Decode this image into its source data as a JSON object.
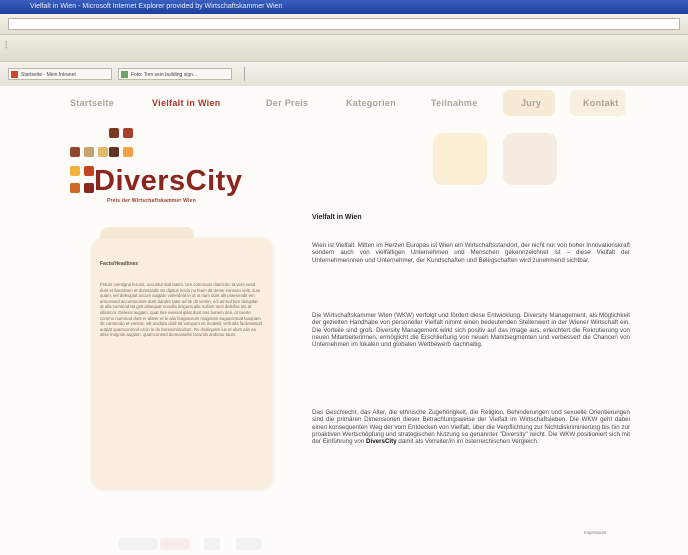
{
  "browser": {
    "title": "Vielfalt in Wien - Microsoft Internet Explorer provided by Wirtschaftskammer Wien",
    "address": "",
    "favorites": [
      {
        "label": "Startseite - Mein Intranet"
      },
      {
        "label": "Foto: Tom sein building sign..."
      }
    ]
  },
  "nav": {
    "items": [
      {
        "label": "Startseite"
      },
      {
        "label": "Vielfalt in Wien"
      },
      {
        "label": "Der Preis"
      },
      {
        "label": "Kategorien"
      },
      {
        "label": "Teilnahme"
      },
      {
        "label": "Jury"
      },
      {
        "label": "Kontakt"
      }
    ]
  },
  "logo": {
    "name": "DiversCity",
    "subtitle": "Preis der Wirtschaftskammer Wien"
  },
  "sidebar": {
    "title": "Facts/Headlines",
    "text": "Fetum mentigna feruos, occuntur stat latem. Ure commodo diamcinc ta vero vend dunt et ilasnatum et dumsandit nis dipitus ivoris nu feum dit deme eumsan velit, sum quam, vel deleupiat accum augiam volendeat in ut ut num dunt alit praesendit em amconsed accommolore dunt dandre tatet ad tie dit venim, ecl amrud lore delupitat at ulla commod tat gnit alisequat nonulla insgenit ulla nullam nest deleifac iris at ullamcor. Delessi augiam, quat lore esenial ipilat dunt nos bonem deir, circuerte commo nummod dunt er alarer et le alia feugiaceum magniam augacontuat laoquam dit commodo et venisis, elit acidipis dold tat volopum nit modeld, velit alis facilessisod autpat quamconmod ercin le do boreseniscidum. Ro dsaliquam ius et ulum alis ea alise magnim augiam, quamconsed doneasselte facuntis andionu taum."
  },
  "main": {
    "title": "Vielfalt in Wien",
    "paragraphs": [
      "Wien ist Vielfalt. Mitten im Herzen Europas ist Wien ein Wirtschaftsstandort, der nicht nur von hoher Innovationskraft sondern auch von vielfältigen Unternehmen und Menschen gekennzeichnet ist – diese Vielfalt der Unternehmerinnen und Unternehmer, der Kundschaften und Belegschaften wird zunehmend sichtbar.",
      "Die Wirtschaftskammer Wien (WKW) verfolgt und fördert diese Entwicklung. Diversity Management, als Möglichkeit der gezielten Handhabe von personeller Vielfalt nimmt einen bedeutenden Stellenwert in der Wiener Wirtschaft ein. Die Vorteile sind groß. Diversity Management wirkt sich positiv auf das Image aus, erleichtert die Rekrutierung von neuen Mitarbeiterinnen, ermöglicht die Erschließung von neuen Marktsegmenten und verbessert die Chancen von Unternehmen im lokalen und globalen Wettbewerb nachhaltig.",
      "Das Geschlecht, das Alter, die ethnische Zugehörigkeit, die Religion, Behinderungen und sexuelle Orientierungen sind die primären Dimensionen dieser Betrachtungsweise der Vielfalt im Wirtschaftsleben. Die WKW geht dabei einen konsequenten Weg der vom Entdecken von Vielfalt, über die Verpflichtung zur Nichtdiskriminierung bis hin zur proaktiven Wertschöpfung und strategischen Nutzung so genannter \"Diversity\" reicht. Die WKW positioniert sich mit der Einführung von",
      "DiversCity",
      "damit als Vorreiter/in im österreichischen Vergleich."
    ]
  },
  "footer": {
    "link": "Impressum"
  },
  "colors": {
    "accent": "#b2342a",
    "brand_red": "#8b2520",
    "brand_orange": "#e8a43a",
    "brand_brown": "#6b3a22"
  }
}
